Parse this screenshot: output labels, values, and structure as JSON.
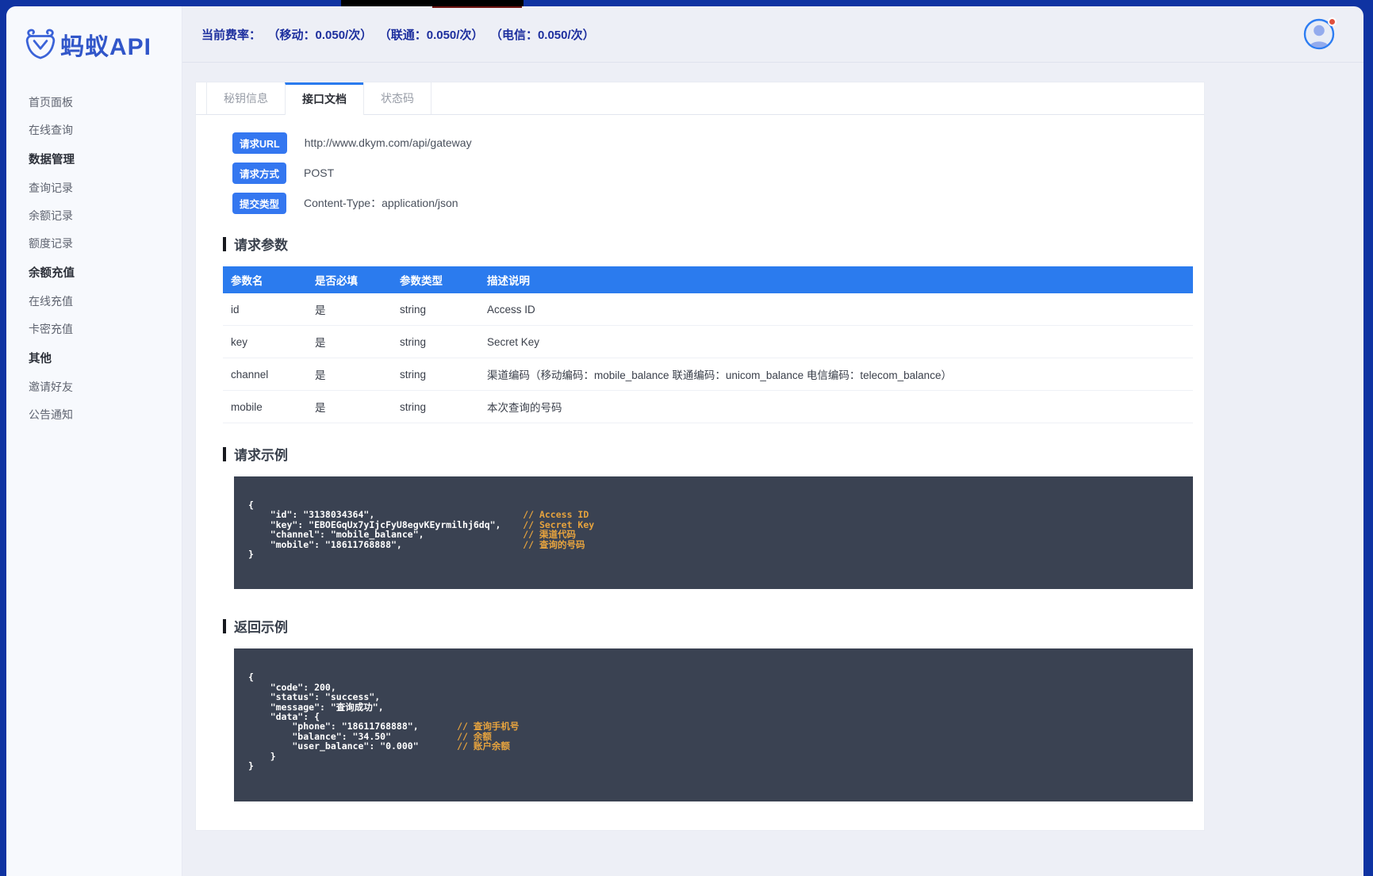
{
  "sidebar": {
    "logo_text": "蚂蚁API",
    "items": [
      {
        "id": "home",
        "label": "首页面板",
        "type": "item"
      },
      {
        "id": "online-query",
        "label": "在线查询",
        "type": "item"
      },
      {
        "id": "data-management",
        "label": "数据管理",
        "type": "header"
      },
      {
        "id": "query-records",
        "label": "查询记录",
        "type": "item"
      },
      {
        "id": "balance-records",
        "label": "余额记录",
        "type": "item"
      },
      {
        "id": "quota-records",
        "label": "额度记录",
        "type": "item"
      },
      {
        "id": "balance-recharge",
        "label": "余额充值",
        "type": "header"
      },
      {
        "id": "online-recharge",
        "label": "在线充值",
        "type": "item"
      },
      {
        "id": "card-recharge",
        "label": "卡密充值",
        "type": "item"
      },
      {
        "id": "other",
        "label": "其他",
        "type": "header"
      },
      {
        "id": "invite-friends",
        "label": "邀请好友",
        "type": "item"
      },
      {
        "id": "announcements",
        "label": "公告通知",
        "type": "item"
      }
    ]
  },
  "topbar": {
    "rate_label": "当前费率：",
    "rates": [
      "（移动：0.050/次）",
      "（联通：0.050/次）",
      "（电信：0.050/次）"
    ]
  },
  "tabs": [
    {
      "id": "key-info",
      "label": "秘钥信息",
      "active": false
    },
    {
      "id": "api-docs",
      "label": "接口文档",
      "active": true
    },
    {
      "id": "status-codes",
      "label": "状态码",
      "active": false
    }
  ],
  "api_info": [
    {
      "badge": "请求URL",
      "value": "http://www.dkym.com/api/gateway"
    },
    {
      "badge": "请求方式",
      "value": "POST"
    },
    {
      "badge": "提交类型",
      "value": "Content-Type：application/json"
    }
  ],
  "sections": {
    "params": "请求参数",
    "request": "请求示例",
    "response": "返回示例"
  },
  "params_table": {
    "headers": [
      "参数名",
      "是否必填",
      "参数类型",
      "描述说明"
    ],
    "rows": [
      {
        "name": "id",
        "required": "是",
        "type": "string",
        "desc": "Access ID"
      },
      {
        "name": "key",
        "required": "是",
        "type": "string",
        "desc": "Secret Key"
      },
      {
        "name": "channel",
        "required": "是",
        "type": "string",
        "desc": "渠道编码（移动编码：mobile_balance 联通编码：unicom_balance 电信编码：telecom_balance）"
      },
      {
        "name": "mobile",
        "required": "是",
        "type": "string",
        "desc": "本次查询的号码"
      }
    ]
  },
  "request_example": {
    "lines": [
      "{",
      "    \"id\": \"3138034364\",                           // Access ID",
      "    \"key\": \"EBOEGqUx7yIjcFyU8egvKEyrmilhj6dq\",    // Secret Key",
      "    \"channel\": \"mobile_balance\",                  // 渠道代码",
      "    \"mobile\": \"18611768888\",                      // 查询的号码",
      "}"
    ]
  },
  "response_example": {
    "lines": [
      "{",
      "    \"code\": 200,",
      "    \"status\": \"success\",",
      "    \"message\": \"查询成功\",",
      "    \"data\": {",
      "        \"phone\": \"18611768888\",       // 查询手机号",
      "        \"balance\": \"34.50\"            // 余额",
      "        \"user_balance\": \"0.000\"       // 账户余额",
      "    }",
      "}"
    ]
  },
  "colors": {
    "frame_blue": "#0f33a2",
    "accent_blue": "#2b7bee",
    "badge_blue": "#3477f0",
    "logo_blue": "#3156c9",
    "rate_text_blue": "#1d2f9e",
    "code_background": "#3a4252",
    "code_comment_orange": "#e6a33e",
    "notification_red": "#e0503c"
  }
}
